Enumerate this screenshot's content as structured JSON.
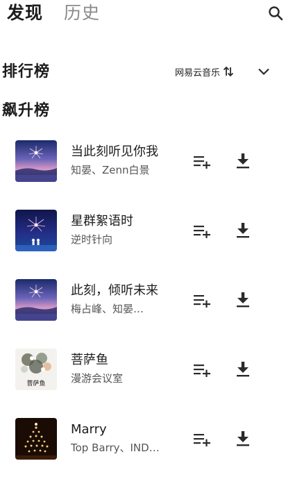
{
  "tabs": {
    "discover": "发现",
    "history": "历史"
  },
  "icons": {
    "search": "search-icon",
    "sort": "sort-arrows-icon",
    "expand": "chevron-down-icon",
    "add_to_playlist": "playlist-add-icon",
    "download": "download-icon"
  },
  "ranking": {
    "title": "排行榜",
    "source": "网易云音乐"
  },
  "soaring": {
    "title": "飙升榜"
  },
  "songs": [
    {
      "title": "当此刻听见你我",
      "artist": "知晏、Zenn白景"
    },
    {
      "title": "星群絮语时",
      "artist": "逆时针向"
    },
    {
      "title": "此刻，倾听未来",
      "artist": "梅占峰、知晏…"
    },
    {
      "title": "菩萨鱼",
      "artist": "漫游会议室"
    },
    {
      "title": "Marry",
      "artist": "Top Barry、IND…"
    }
  ],
  "cover_texts": {
    "song_4": "菩萨鱼"
  },
  "colors": {
    "text_primary": "#1c1c1c",
    "text_secondary": "#555555",
    "tab_inactive": "#8a8a8a",
    "icon": "#2a2a2a"
  }
}
